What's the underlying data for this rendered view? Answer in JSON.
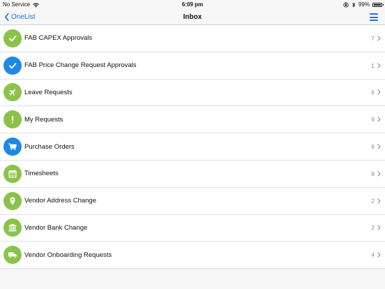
{
  "status": {
    "carrier": "No Service",
    "time": "6:09 pm",
    "battery": "99%",
    "battery_level": 0.99
  },
  "nav": {
    "back_label": "OneList",
    "title": "Inbox"
  },
  "colors": {
    "accent": "#1a73d9",
    "green": "#8bc34a",
    "blue": "#1e88e5"
  },
  "inbox": [
    {
      "label": "FAB CAPEX Approvals",
      "count": "7",
      "icon": "check-icon",
      "color": "#8bc34a"
    },
    {
      "label": "FAB Price Change Request Approvals",
      "count": "1",
      "icon": "check-icon",
      "color": "#1e88e5"
    },
    {
      "label": "Leave Requests",
      "count": "6",
      "icon": "airplane-icon",
      "color": "#8bc34a"
    },
    {
      "label": "My Requests",
      "count": "9",
      "icon": "exclamation-icon",
      "color": "#8bc34a"
    },
    {
      "label": "Purchase Orders",
      "count": "6",
      "icon": "cart-icon",
      "color": "#1e88e5"
    },
    {
      "label": "Timesheets",
      "count": "8",
      "icon": "calendar-icon",
      "color": "#8bc34a"
    },
    {
      "label": "Vendor Address Change",
      "count": "2",
      "icon": "location-pin-icon",
      "color": "#8bc34a"
    },
    {
      "label": "Vendor Bank Change",
      "count": "2",
      "icon": "bank-icon",
      "color": "#8bc34a"
    },
    {
      "label": "Vendor Onboarding Requests",
      "count": "4",
      "icon": "truck-icon",
      "color": "#8bc34a"
    }
  ]
}
